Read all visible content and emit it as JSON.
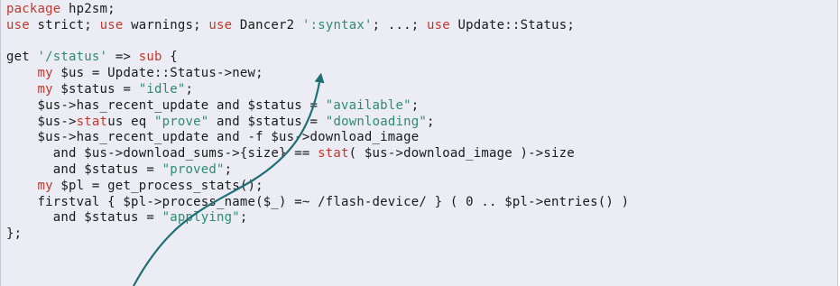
{
  "code": {
    "lines": [
      [
        {
          "t": "package",
          "c": "kw"
        },
        {
          "t": " hp2sm;"
        }
      ],
      [
        {
          "t": "use",
          "c": "kw"
        },
        {
          "t": " strict; "
        },
        {
          "t": "use",
          "c": "kw"
        },
        {
          "t": " warnings; "
        },
        {
          "t": "use",
          "c": "kw"
        },
        {
          "t": " Dancer2 "
        },
        {
          "t": "':syntax'",
          "c": "str"
        },
        {
          "t": "; ...; "
        },
        {
          "t": "use",
          "c": "kw"
        },
        {
          "t": " Update::Status;"
        }
      ],
      [
        {
          "t": ""
        }
      ],
      [
        {
          "t": "get "
        },
        {
          "t": "'/status'",
          "c": "str"
        },
        {
          "t": " => "
        },
        {
          "t": "sub",
          "c": "kw"
        },
        {
          "t": " {"
        }
      ],
      [
        {
          "t": "    "
        },
        {
          "t": "my",
          "c": "kw"
        },
        {
          "t": " $us = Update::Status->new;"
        }
      ],
      [
        {
          "t": "    "
        },
        {
          "t": "my",
          "c": "kw"
        },
        {
          "t": " $status = "
        },
        {
          "t": "\"idle\"",
          "c": "str"
        },
        {
          "t": ";"
        }
      ],
      [
        {
          "t": "    $us->has_recent_update and $status = "
        },
        {
          "t": "\"available\"",
          "c": "str"
        },
        {
          "t": ";"
        }
      ],
      [
        {
          "t": "    $us->"
        },
        {
          "t": "stat",
          "c": "kw"
        },
        {
          "t": "us eq "
        },
        {
          "t": "\"prove\"",
          "c": "str"
        },
        {
          "t": " and $status = "
        },
        {
          "t": "\"downloading\"",
          "c": "str"
        },
        {
          "t": ";"
        }
      ],
      [
        {
          "t": "    $us->has_recent_update and -f $us->download_image"
        }
      ],
      [
        {
          "t": "      and $us->download_sums->{size} == "
        },
        {
          "t": "stat",
          "c": "kw"
        },
        {
          "t": "( $us->download_image )->size"
        }
      ],
      [
        {
          "t": "      and $status = "
        },
        {
          "t": "\"proved\"",
          "c": "str"
        },
        {
          "t": ";"
        }
      ],
      [
        {
          "t": "    "
        },
        {
          "t": "my",
          "c": "kw"
        },
        {
          "t": " $pl = get_process_stats();"
        }
      ],
      [
        {
          "t": "    firstval { $pl->process_name($_) =~ /flash-device/ } ( 0 .. $pl->entries() )"
        }
      ],
      [
        {
          "t": "      and $status = "
        },
        {
          "t": "\"applying\"",
          "c": "str"
        },
        {
          "t": ";"
        }
      ],
      [
        {
          "t": "};"
        }
      ]
    ]
  },
  "colors": {
    "background": "#ececf5",
    "keyword": "#c0392b",
    "string": "#2e8b6e",
    "text": "#1a1a1a",
    "arrow": "#1f6f73"
  },
  "arrow": {
    "icon": "curved-arrow-icon"
  }
}
